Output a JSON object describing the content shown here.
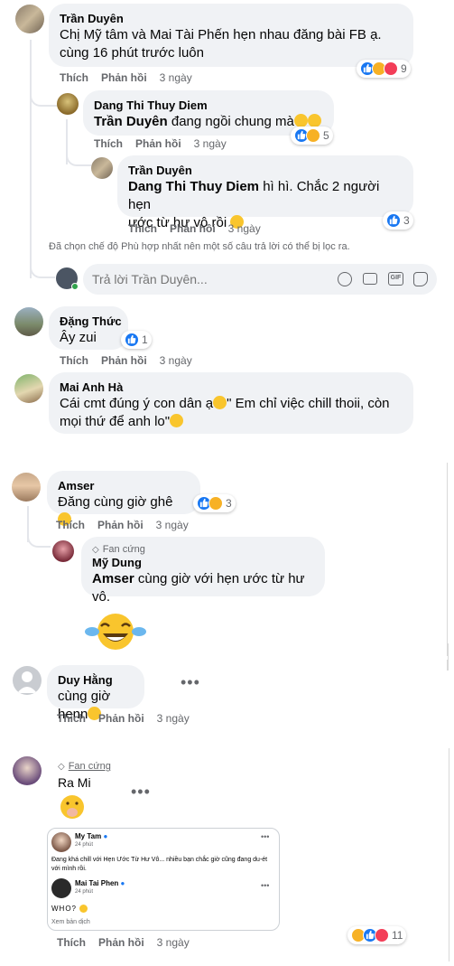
{
  "comment1": {
    "author": "Trần Duyên",
    "text_line1": "Chị Mỹ tâm và Mai Tài Phến hẹn nhau đăng bài FB ạ.",
    "text_line2": "cùng 16 phút trước luôn",
    "like": "Thích",
    "reply": "Phản hồi",
    "time": "3 ngày",
    "reaction_count": "9"
  },
  "reply1": {
    "author": "Dang Thi Thuy Diem",
    "mention": "Trần Duyên",
    "text": "đang ngồi chung mà",
    "like": "Thích",
    "reply": "Phản hồi",
    "time": "3 ngày",
    "reaction_count": "5"
  },
  "reply2": {
    "author": "Trần Duyên",
    "mention": "Dang Thi Thuy Diem",
    "text_line1": "hì hì. Chắc 2 người hẹn",
    "text_line2": "ước từ hư vô rồi",
    "like": "Thích",
    "reply": "Phản hồi",
    "time": "3 ngày",
    "reaction_count": "3"
  },
  "filter_notice": "Đã chọn chế độ Phù hợp nhất nên một số câu trả lời có thể bị lọc ra.",
  "reply_box": {
    "placeholder": "Trả lời Trần Duyên..."
  },
  "comment2": {
    "author": "Đặng Thức",
    "text": "Ây zui",
    "like": "Thích",
    "reply": "Phản hồi",
    "time": "3 ngày",
    "reaction_count": "1"
  },
  "comment3": {
    "author": "Mai Anh Hà",
    "text_line1": "Cái cmt đúng ý con dân ạ",
    "text_line1b": "\" Em chỉ việc chill thoii, còn",
    "text_line2": "mọi thứ để anh lo\""
  },
  "comment4": {
    "author": "Amser",
    "text": "Đăng cùng giờ ghê",
    "like": "Thích",
    "reply": "Phản hồi",
    "time": "3 ngày",
    "reaction_count": "3"
  },
  "reply3": {
    "badge": "Fan cứng",
    "author": "Mỹ Dung",
    "mention": "Amser",
    "text": "cùng giờ với hẹn ước từ hư vô."
  },
  "comment5": {
    "author": "Duy Hằng",
    "text": "cùng giờ henn",
    "like": "Thích",
    "reply": "Phản hồi",
    "time": "3 ngày"
  },
  "comment6": {
    "badge": "Fan cứng",
    "author": "Ra Mi",
    "like": "Thích",
    "reply": "Phản hồi",
    "time": "3 ngày",
    "reaction_count": "11",
    "screenshot": {
      "post1_author": "My Tam",
      "post1_time": "24 phút",
      "post1_text": "Đang khá chill với Hẹn Ước Từ Hư Vô... nhiều bạn chắc giờ cũng đang du-ét với mình rồi.",
      "post2_author": "Mai Tai Phen",
      "post2_time": "24 phút",
      "post2_text": "WHO?",
      "translate": "Xem bản dịch"
    }
  },
  "colors": {
    "bubble": "#f0f2f5",
    "meta": "#65676b",
    "like_blue": "#1877f2",
    "haha_yellow": "#f7b125",
    "love_red": "#f33e58"
  }
}
